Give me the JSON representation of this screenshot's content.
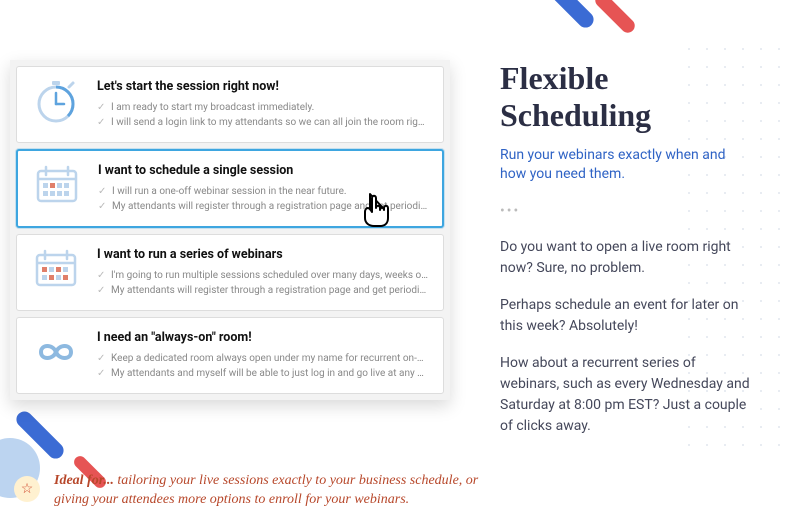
{
  "options": [
    {
      "title": "Let's start the session right now!",
      "bullets": [
        "I am ready to start my broadcast immediately.",
        "I will send a login link to my attendants so we can all join the room right away."
      ],
      "icon": "stopwatch-icon",
      "selected": false
    },
    {
      "title": "I want to schedule a single session",
      "bullets": [
        "I will run a one-off webinar session in the near future.",
        "My attendants will register through a registration page and get periodical reminders."
      ],
      "icon": "calendar-single-icon",
      "selected": true
    },
    {
      "title": "I want to run a series of webinars",
      "bullets": [
        "I'm going to run multiple sessions scheduled over many days, weeks or even months!",
        "My attendants will register through a registration page and get periodical reminders."
      ],
      "icon": "calendar-series-icon",
      "selected": false
    },
    {
      "title": "I need an \"always-on\" room!",
      "bullets": [
        "Keep a dedicated room always open under my name for recurrent on-demand use.",
        "My attendants and myself will be able to just log in and go live at any moment we wish."
      ],
      "icon": "infinity-icon",
      "selected": false
    }
  ],
  "ideal": {
    "prefix": "Ideal for...",
    "text": " tailoring your live sessions exactly to your business schedule, or giving your attendees more options to enroll for your webinars."
  },
  "right": {
    "title": "Flexible Scheduling",
    "subtitle": "Run your webinars exactly when and how you need them.",
    "p1": "Do you want to open a live room right now? Sure, no problem.",
    "p2": "Perhaps schedule an event for later on this week? Absolutely!",
    "p3": "How about a recurrent series of webinars, such as every Wednesday and Saturday at 8:00 pm EST? Just a couple of clicks away."
  }
}
